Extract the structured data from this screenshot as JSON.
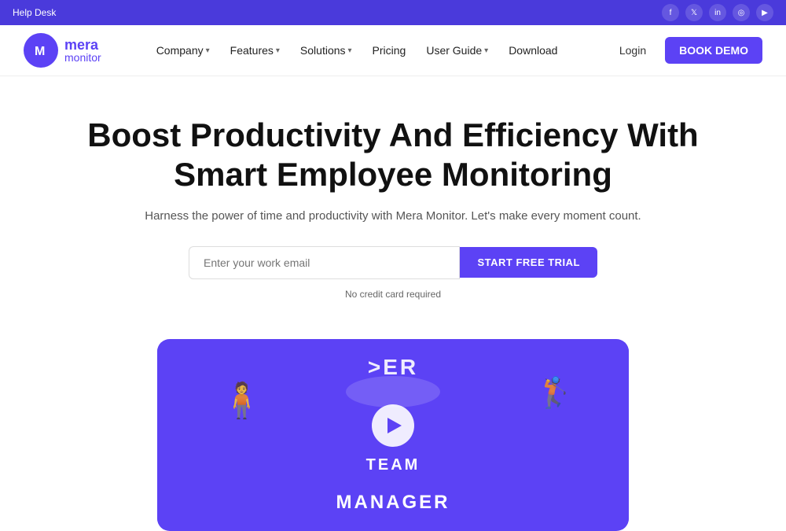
{
  "topbar": {
    "help_desk": "Help Desk",
    "social_icons": [
      {
        "name": "facebook-icon",
        "symbol": "f"
      },
      {
        "name": "twitter-icon",
        "symbol": "t"
      },
      {
        "name": "linkedin-icon",
        "symbol": "in"
      },
      {
        "name": "instagram-icon",
        "symbol": "ig"
      },
      {
        "name": "youtube-icon",
        "symbol": "▶"
      }
    ]
  },
  "navbar": {
    "logo_letter": "M",
    "logo_name_top": "mera",
    "logo_name_bot": "monitor",
    "nav_items": [
      {
        "label": "Company",
        "has_dropdown": true
      },
      {
        "label": "Features",
        "has_dropdown": true
      },
      {
        "label": "Solutions",
        "has_dropdown": true
      },
      {
        "label": "Pricing",
        "has_dropdown": false
      },
      {
        "label": "User Guide",
        "has_dropdown": true
      },
      {
        "label": "Download",
        "has_dropdown": false
      }
    ],
    "login_label": "Login",
    "book_demo_label": "BOOK DEMO"
  },
  "hero": {
    "title_line1": "Boost Productivity And Efficiency With",
    "title_line2": "Smart Employee Monitoring",
    "subtitle": "Harness the power of time and productivity with Mera Monitor. Let's make every moment count.",
    "email_placeholder": "Enter your work email",
    "cta_button": "START FREE TRIAL",
    "no_cc": "No credit card required"
  },
  "video": {
    "top_text": ">ER",
    "team_label": "TEAM",
    "manager_label": "MANAGER"
  },
  "colors": {
    "brand": "#5c42f5",
    "topbar_bg": "#4a3adb"
  }
}
